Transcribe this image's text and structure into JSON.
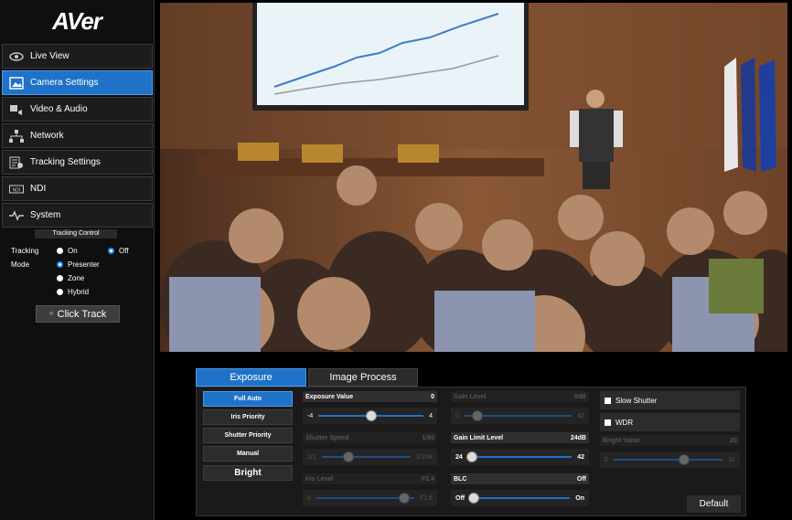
{
  "brand": "AVer",
  "nav": [
    {
      "label": "Live View",
      "icon": "eye-icon"
    },
    {
      "label": "Camera Settings",
      "icon": "image-icon"
    },
    {
      "label": "Video & Audio",
      "icon": "video-audio-icon"
    },
    {
      "label": "Network",
      "icon": "network-icon"
    },
    {
      "label": "Tracking Settings",
      "icon": "tracking-settings-icon"
    },
    {
      "label": "NDI",
      "icon": "ndi-icon"
    },
    {
      "label": "System",
      "icon": "system-icon"
    }
  ],
  "tracking": {
    "header": "Tracking Control",
    "label_line1": "Tracking",
    "label_line2": "Mode",
    "on": "On",
    "off": "Off",
    "modes": [
      "Presenter",
      "Zone",
      "Hybrid"
    ],
    "click_track": "Click Track"
  },
  "tabs": {
    "exposure": "Exposure",
    "image_process": "Image Process"
  },
  "exposure_modes": [
    "Full Auto",
    "Iris Priority",
    "Shutter Priority",
    "Manual",
    "Bright"
  ],
  "controls": {
    "exposure_value": {
      "label": "Exposure Value",
      "value": "0",
      "min": "-4",
      "max": "4"
    },
    "shutter_speed": {
      "label": "Shutter Speed",
      "value": "1/60",
      "min": "1/1",
      "max": "1/10K"
    },
    "iris_level": {
      "label": "Iris Level",
      "value": "F2.4",
      "min": "0",
      "max": "F1.6"
    },
    "gain_level": {
      "label": "Gain Level",
      "value": "0dB",
      "min": "0",
      "max": "42"
    },
    "gain_limit": {
      "label": "Gain Limit Level",
      "value": "24dB",
      "min": "24",
      "max": "42"
    },
    "blc": {
      "label": "BLC",
      "value": "Off",
      "min": "Off",
      "max": "On"
    },
    "bright_value": {
      "label": "Bright Value",
      "value": "20",
      "min": "0",
      "max": "31"
    }
  },
  "checkboxes": {
    "slow_shutter": "Slow Shutter",
    "wdr": "WDR"
  },
  "default_btn": "Default"
}
